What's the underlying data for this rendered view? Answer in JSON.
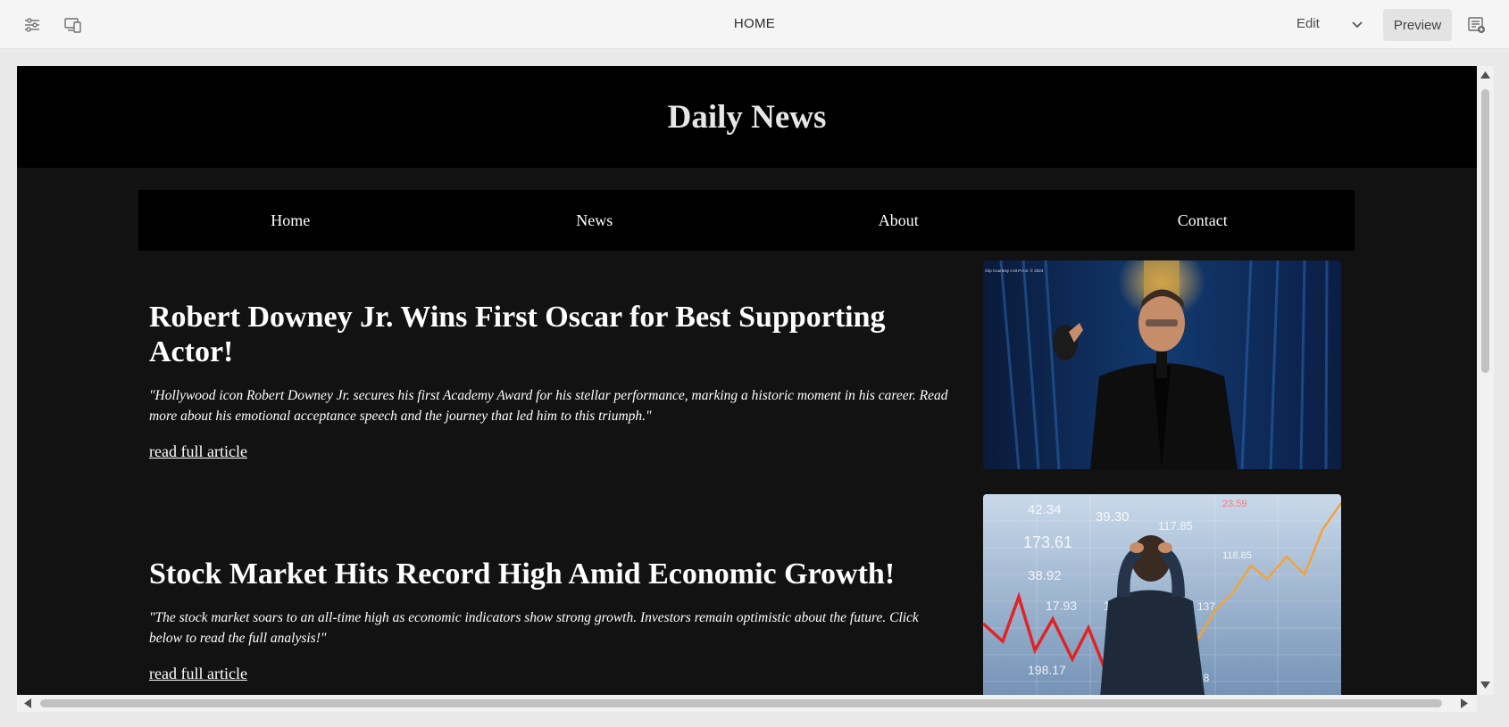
{
  "toolbar": {
    "title": "HOME",
    "edit_label": "Edit",
    "preview_label": "Preview",
    "icons": [
      "sliders-icon",
      "responsive-devices-icon",
      "chevron-down-icon",
      "page-info-icon"
    ]
  },
  "site": {
    "title": "Daily News",
    "nav": [
      "Home",
      "News",
      "About",
      "Contact"
    ]
  },
  "articles": [
    {
      "title": "Robert Downey Jr. Wins First Oscar for Best Supporting Actor!",
      "summary": "\"Hollywood icon Robert Downey Jr. secures his first Academy Award for his stellar performance, marking a historic moment in his career. Read more about his emotional acceptance speech and the journey that led him to this triumph.\"",
      "link": "read full article",
      "image_caption": "Clip Courtesy A.M.P.A.S. © 2024"
    },
    {
      "title": "Stock Market Hits Record High Amid Economic Growth!",
      "summary": "\"The stock market soars to an all-time high as economic indicators show strong growth. Investors remain optimistic about the future. Click below to read the full analysis!\"",
      "link": "read full article",
      "image_numbers": [
        "42.34",
        "39.30",
        "117.85",
        "23.59",
        "173.61",
        "38.92",
        "17.93",
        "195",
        "198.17",
        "58",
        "137",
        "118.85"
      ]
    }
  ],
  "colors": {
    "header_bg": "#000000",
    "page_bg": "#121212",
    "text": "#ffffff",
    "chart_red": "#e02424",
    "chart_orange": "#f2a33a"
  }
}
